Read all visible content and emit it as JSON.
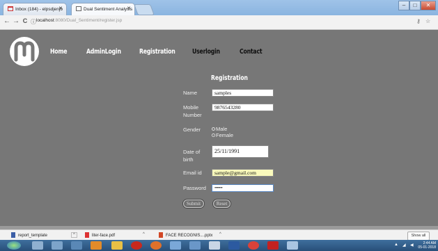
{
  "browser": {
    "tabs": [
      {
        "label": "Inbox (184) - elpsdjenjo",
        "favicon": "gmail-icon"
      },
      {
        "label": "Dual Sentiment Analysis",
        "favicon": "page-icon"
      }
    ],
    "url_host": "localhost",
    "url_path": ":8080/Dual_Sentiment/register.jsp",
    "nav": {
      "back": "←",
      "forward": "→",
      "reload": "C",
      "info": "ⓘ"
    }
  },
  "site": {
    "nav": [
      "Home",
      "AdminLogin",
      "Registration",
      "Userlogin",
      "Contact"
    ]
  },
  "form": {
    "title": "Registration",
    "name_label": "Name",
    "name_value": "samples",
    "mobile_label": "Mobile Number",
    "mobile_value": "9876543280",
    "gender_label": "Gender",
    "gender_options": [
      "Male",
      "Female"
    ],
    "gender_selected": "Female",
    "dob_label": "Date of birth",
    "dob_value": "25/11/1991",
    "email_label": "Email id",
    "email_value": "sample@gmail.com",
    "password_label": "Password",
    "password_value": "•••••••",
    "submit_label": "Submit",
    "reset_label": "Reset"
  },
  "downloads": {
    "items": [
      "report_template",
      "liter-face.pdf",
      "FACE RECOGNIS....pptx"
    ],
    "show_all": "Show all"
  },
  "taskbar": {
    "time": "2:44 AM",
    "date": "05-01-2018"
  },
  "colors": {
    "page_bg": "#777777",
    "email_autofill": "#fafabc"
  }
}
